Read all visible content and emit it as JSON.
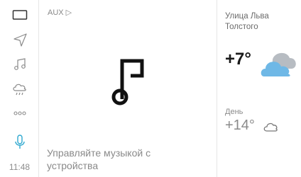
{
  "sidebar": {
    "items": [
      {
        "icon": "screen-icon"
      },
      {
        "icon": "navigation-icon"
      },
      {
        "icon": "music-icon"
      },
      {
        "icon": "weather-icon"
      },
      {
        "icon": "more-icon"
      },
      {
        "icon": "microphone-icon"
      }
    ],
    "clock": "11:48",
    "accent_color": "#2ea8cf"
  },
  "main": {
    "source_label": "AUX ▷",
    "hint_text": "Управляйте музыкой с устройства",
    "note_icon": "music-note-icon"
  },
  "weather": {
    "street": "Улица Льва Толстого",
    "current_temp": "+7°",
    "current_icon": "cloudy-icon",
    "day_label": "День",
    "day_temp": "+14°",
    "day_icon": "cloud-outline-icon",
    "cloud_colors": {
      "front": "#6fb8e6",
      "back": "#b7bcc2"
    }
  }
}
